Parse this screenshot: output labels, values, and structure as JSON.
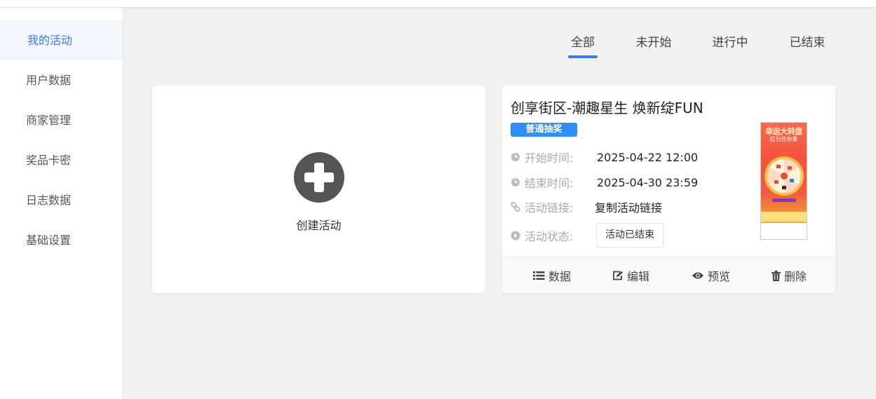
{
  "sidebar": {
    "items": [
      {
        "label": "我的活动"
      },
      {
        "label": "用户数据"
      },
      {
        "label": "商家管理"
      },
      {
        "label": "奖品卡密"
      },
      {
        "label": "日志数据"
      },
      {
        "label": "基础设置"
      }
    ],
    "active_index": 0
  },
  "tabs": {
    "items": [
      {
        "label": "全部"
      },
      {
        "label": "未开始"
      },
      {
        "label": "进行中"
      },
      {
        "label": "已结束"
      }
    ],
    "active_index": 0
  },
  "create_card": {
    "label": "创建活动",
    "icon": "plus-circle-icon"
  },
  "activity": {
    "title": "创享街区-潮趣星生 焕新绽FUN",
    "badge": "普通抽奖",
    "start_label": "开始时间:",
    "start_value": "2025-04-22 12:00",
    "end_label": "结束时间:",
    "end_value": "2025-04-30 23:59",
    "link_label": "活动链接:",
    "link_value": "复制活动链接",
    "status_label": "活动状态:",
    "status_value": "活动已结束",
    "thumbnail": {
      "title": "幸运大转盘",
      "subtitle": "红包任你拿"
    }
  },
  "actions": {
    "data": "数据",
    "edit": "编辑",
    "preview": "预览",
    "delete": "删除"
  },
  "colors": {
    "accent": "#3b7be0",
    "badge": "#2f8ff5",
    "background": "#f1f1f1"
  }
}
